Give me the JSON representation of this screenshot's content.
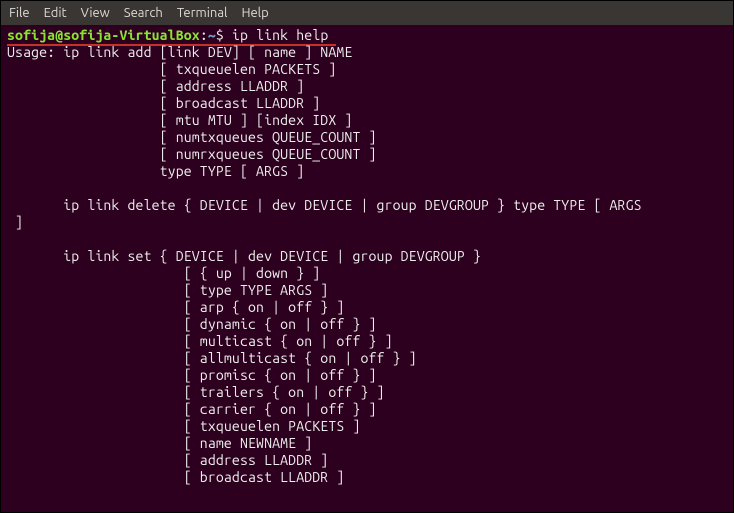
{
  "menubar": {
    "file": "File",
    "edit": "Edit",
    "view": "View",
    "search": "Search",
    "terminal": "Terminal",
    "help": "Help"
  },
  "prompt": {
    "userhost": "sofija@sofija-VirtualBox",
    "colon": ":",
    "path": "~",
    "dollar": "$ "
  },
  "command": "ip link help",
  "output": "Usage: ip link add [link DEV] [ name ] NAME\n                   [ txqueuelen PACKETS ]\n                   [ address LLADDR ]\n                   [ broadcast LLADDR ]\n                   [ mtu MTU ] [index IDX ]\n                   [ numtxqueues QUEUE_COUNT ]\n                   [ numrxqueues QUEUE_COUNT ]\n                   type TYPE [ ARGS ]\n\n       ip link delete { DEVICE | dev DEVICE | group DEVGROUP } type TYPE [ ARGS\n ]\n\n       ip link set { DEVICE | dev DEVICE | group DEVGROUP }\n                      [ { up | down } ]\n                      [ type TYPE ARGS ]\n                      [ arp { on | off } ]\n                      [ dynamic { on | off } ]\n                      [ multicast { on | off } ]\n                      [ allmulticast { on | off } ]\n                      [ promisc { on | off } ]\n                      [ trailers { on | off } ]\n                      [ carrier { on | off } ]\n                      [ txqueuelen PACKETS ]\n                      [ name NEWNAME ]\n                      [ address LLADDR ]\n                      [ broadcast LLADDR ]"
}
